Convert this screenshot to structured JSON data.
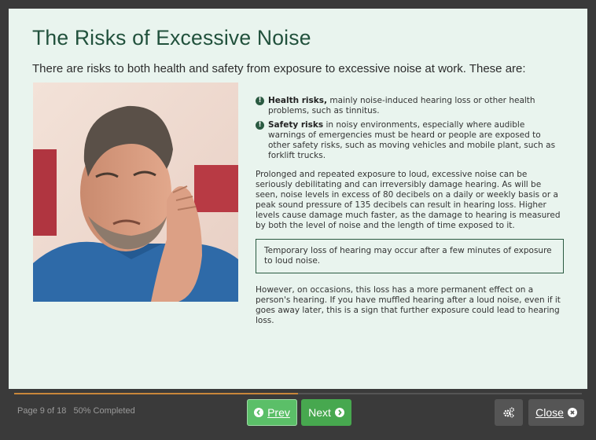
{
  "title": "The Risks of Excessive Noise",
  "intro": "There are risks to both health and safety from exposure to excessive noise at work. These are:",
  "bullets": [
    {
      "bold": "Health risks,",
      "text": " mainly noise-induced hearing loss or other health problems, such as tinnitus."
    },
    {
      "bold": "Safety risks",
      "text": " in noisy environments, especially where audible warnings of emergencies must be heard or people are exposed to other safety risks, such as moving vehicles and mobile plant, such as forklift trucks."
    }
  ],
  "paragraph1": "Prolonged and repeated exposure to loud, excessive noise can be seriously debilitating and can irreversibly damage hearing. As will be seen, noise levels in excess of 80 decibels on a daily or weekly basis or a peak sound pressure of 135 decibels can result in hearing loss. Higher levels cause damage much faster, as the damage to hearing is measured by both the level of noise and the length of time exposed to it.",
  "callout": "Temporary loss of hearing may occur after a few minutes of exposure to loud noise.",
  "paragraph2": "However, on occasions, this loss has a more permanent effect on a person's hearing. If you have muffled hearing after a loud noise, even if it goes away later, this is a sign that further exposure could lead to hearing loss.",
  "footer": {
    "page_text": "Page 9 of 18",
    "completed_text": "50% Completed",
    "progress": 0.5,
    "prev_label": "Prev",
    "next_label": "Next",
    "close_label": "Close"
  },
  "colors": {
    "title": "#21513c",
    "panel": "#e9f4ee",
    "accent_green": "#47a84f",
    "progress": "#c8873a"
  },
  "icons": {
    "bullet": "info-icon",
    "prev": "chevron-left-circle-icon",
    "next": "chevron-right-circle-icon",
    "settings": "gears-icon",
    "close": "close-circle-icon"
  }
}
